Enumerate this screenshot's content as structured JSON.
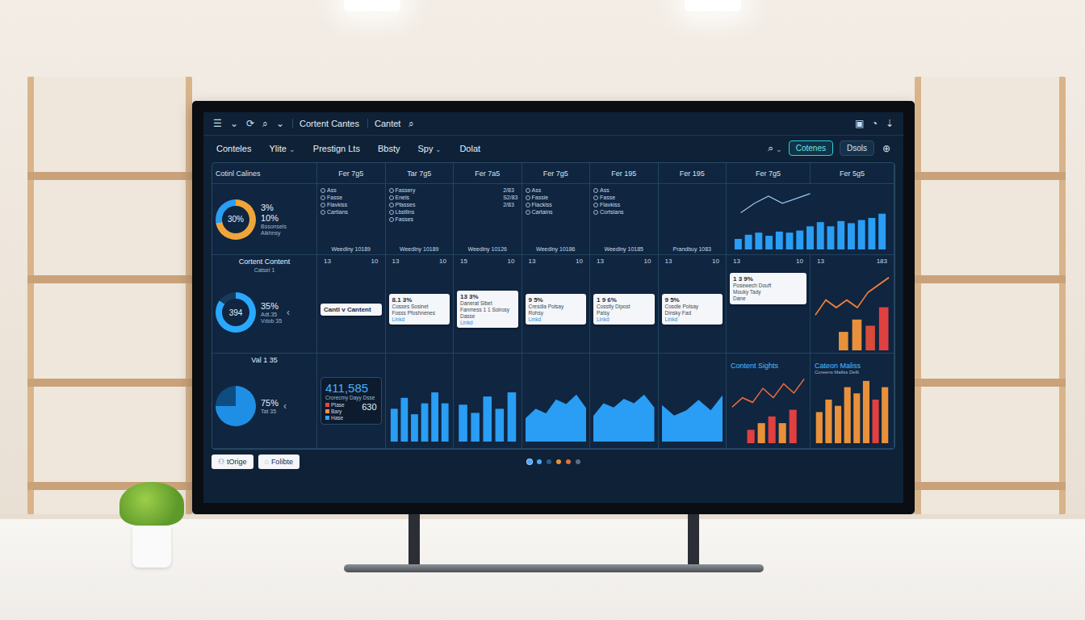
{
  "top_bar": {
    "menu_icon": "☰",
    "icons": [
      "⌄",
      "⟳",
      "⌕",
      "⌄"
    ],
    "title": "Cortent Cantes",
    "tab": "Cantet",
    "search_icon": "⌕",
    "right_icons": [
      "▣",
      "◔",
      "⇣"
    ]
  },
  "nav": {
    "caret": "⌄",
    "items": [
      {
        "label": "Conteles",
        "dropdown": false
      },
      {
        "label": "Ylite",
        "dropdown": true
      },
      {
        "label": "Prestign Lts",
        "dropdown": false
      },
      {
        "label": "Bbsty",
        "dropdown": false
      },
      {
        "label": "Spy",
        "dropdown": true
      },
      {
        "label": "Dolat",
        "dropdown": false
      }
    ],
    "search_icon": "⌕",
    "buttons": [
      {
        "label": "Cotenes",
        "selected": true
      },
      {
        "label": "Dsols",
        "selected": false
      }
    ],
    "extra_icon": "⊕"
  },
  "grid": {
    "corner": "Cotinl Calines",
    "headers": [
      "Fer 7g5",
      "Tar 7g5",
      "Fer 7a5",
      "Fer 7g5",
      "Fer 195",
      "Fer 195",
      "Fer 7g5",
      "Fer 5g5"
    ]
  },
  "side": [
    {
      "kind": "donut",
      "titles": [],
      "center": "30%",
      "values": [
        "3%",
        "10%"
      ],
      "lines": [
        "Bssonsels",
        "Aikhnsy"
      ],
      "level": 0.72,
      "arrows": []
    },
    {
      "kind": "ring",
      "titles": [
        "Cortent Content",
        "Catsel 1"
      ],
      "center": "394",
      "values": [
        "35%"
      ],
      "lines": [
        "Adt.35",
        "Vdob 35"
      ],
      "level": 0.85,
      "arrows": [
        "‹"
      ]
    },
    {
      "kind": "pie",
      "titles": [
        "Val 1 35"
      ],
      "center": "75%",
      "values": [],
      "lines": [
        "Tat 35"
      ],
      "level": 0.75,
      "arrows": [
        "‹"
      ]
    }
  ],
  "week": [
    {
      "items": [
        "Ass",
        "Fasse",
        "Flavkiss",
        "Cartians"
      ],
      "counts": [],
      "footer": "Weedlny 10189"
    },
    {
      "items": [
        "Fassery",
        "Enels",
        "Pfasses",
        "Lbstlins",
        "Fasses"
      ],
      "counts": [],
      "footer": "Weedlny 10189"
    },
    {
      "items": [],
      "counts": [
        "2/83",
        "S2/83",
        "2/83"
      ],
      "footer": "Weedlny 10126"
    },
    {
      "items": [
        "Ass",
        "Fassie",
        "Flackiss",
        "Cartains"
      ],
      "counts": [],
      "footer": "Weedlny 10186"
    },
    {
      "items": [
        "Ass",
        "Fasse",
        "Flavkiss",
        "Cortsians"
      ],
      "counts": [],
      "footer": "Weedlny 10185"
    },
    {
      "items": [],
      "counts": [],
      "footer": "Prandbuy 1083"
    }
  ],
  "trend": {
    "bars": [
      10,
      14,
      16,
      13,
      17,
      16,
      18,
      22,
      26,
      22,
      27,
      25,
      28,
      30,
      34
    ],
    "line": [
      20,
      24,
      27,
      24,
      26,
      28
    ]
  },
  "days": [
    [
      "13",
      "10"
    ],
    [
      "13",
      "10"
    ],
    [
      "15",
      "10"
    ],
    [
      "13",
      "10"
    ],
    [
      "13",
      "10"
    ],
    [
      "13",
      "10"
    ],
    [
      "13",
      "10"
    ],
    [
      "13",
      "183"
    ]
  ],
  "notes": [
    {
      "cards": [
        {
          "title": "Cantl v Cantent",
          "lines": [],
          "link": ""
        }
      ]
    },
    {
      "cards": [
        {
          "title": "8.1 3%",
          "lines": [
            "Cosses Sosinet",
            "Fosss Pfoshnenes"
          ],
          "link": "Linkd"
        }
      ]
    },
    {
      "cards": [
        {
          "title": "13 3%",
          "lines": [
            "Danerat Sibet",
            "Fanmess 1 1 Solrosy",
            "Dasse"
          ],
          "link": "Linkd"
        }
      ]
    },
    {
      "cards": [
        {
          "title": "9 5%",
          "lines": [
            "Cresdla Polsay",
            "Rohsy"
          ],
          "link": "Linkd"
        }
      ]
    },
    {
      "cards": [
        {
          "title": "1 9 6%",
          "lines": [
            "Cosstly Dipost",
            "Palsy"
          ],
          "link": "Linkd"
        }
      ]
    },
    {
      "cards": [
        {
          "title": "9 5%",
          "lines": [
            "Cosdle Polsay",
            "Dinsky Fad"
          ],
          "link": "Linkd"
        }
      ]
    }
  ],
  "side_card": {
    "title": "1 3 9%",
    "lines": [
      "Posewech Douft",
      "Mouky Tady",
      "Dane"
    ]
  },
  "mix_chart": {
    "line": [
      4,
      6,
      5,
      6,
      5,
      7,
      8,
      9
    ],
    "bars": [
      {
        "value": 3,
        "color": "#e8913a"
      },
      {
        "value": 5,
        "color": "#e8913a"
      },
      {
        "value": 4,
        "color": "#d84a3a"
      },
      {
        "value": 7,
        "color": "#e04040"
      }
    ]
  },
  "stat": {
    "value": "411,585",
    "caption": "Crorecmy Dayy Dsse",
    "side": "630",
    "legend": [
      {
        "label": "Ptase",
        "color": "#e04848"
      },
      {
        "label": "Bary",
        "color": "#ff8c40"
      },
      {
        "label": "Hase",
        "color": "#3aa0ff"
      }
    ]
  },
  "minis": [
    {
      "kind": "bars",
      "values": [
        6,
        8,
        5,
        7,
        9,
        7
      ]
    },
    {
      "kind": "bars",
      "values": [
        9,
        7,
        11,
        8,
        12
      ]
    },
    {
      "kind": "area",
      "values": [
        5,
        7,
        6,
        9,
        8,
        10,
        7
      ]
    },
    {
      "kind": "area",
      "values": [
        6,
        9,
        8,
        10,
        9,
        11,
        8
      ]
    },
    {
      "kind": "area",
      "values": [
        7,
        5,
        6,
        8,
        6,
        9
      ]
    }
  ],
  "sights": {
    "title": "Content Sights",
    "line": [
      3,
      5,
      4,
      7,
      5,
      8,
      6,
      9
    ],
    "bars": [
      {
        "value": 2,
        "color": "#e04040"
      },
      {
        "value": 3,
        "color": "#e8913a"
      },
      {
        "value": 4,
        "color": "#e04040"
      },
      {
        "value": 3,
        "color": "#e8913a"
      },
      {
        "value": 5,
        "color": "#e04040"
      }
    ]
  },
  "maliss": {
    "title": "Cateon Maliss",
    "subtitle": "Coreens Mallss Dellt",
    "bars": [
      {
        "value": 5,
        "color": "#e8913a"
      },
      {
        "value": 7,
        "color": "#e8913a"
      },
      {
        "value": 6,
        "color": "#e8913a"
      },
      {
        "value": 9,
        "color": "#e8913a"
      },
      {
        "value": 8,
        "color": "#e8913a"
      },
      {
        "value": 10,
        "color": "#e8913a"
      },
      {
        "value": 7,
        "color": "#e04040"
      },
      {
        "value": 9,
        "color": "#e8913a"
      }
    ]
  },
  "footer": {
    "buttons": [
      {
        "icon": "⚇",
        "label": "tOrige"
      },
      {
        "icon": "◌",
        "label": "Folibte"
      }
    ],
    "dots": [
      {
        "color": "#4aa8ff",
        "selected": true
      },
      {
        "color": "#4aa8ff",
        "selected": false
      },
      {
        "color": "#2a5c8a",
        "selected": false
      },
      {
        "color": "#e8913a",
        "selected": false
      },
      {
        "color": "#e07040",
        "selected": false
      },
      {
        "color": "#5a6f85",
        "selected": false
      }
    ]
  }
}
